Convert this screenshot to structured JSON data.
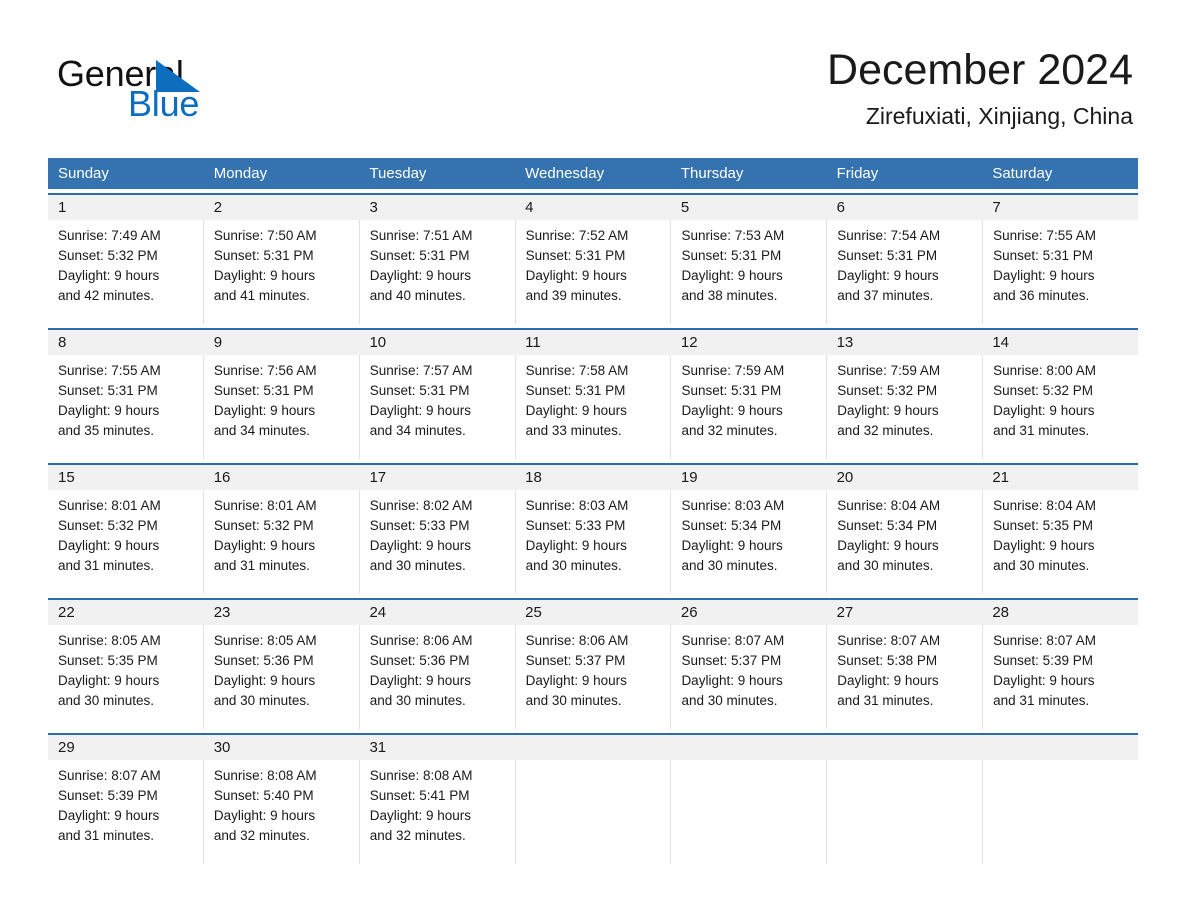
{
  "brand": {
    "name_part1": "General",
    "name_part2": "Blue",
    "triangle_color": "#0d6ebd",
    "blue_text_color": "#0d6ebd"
  },
  "header": {
    "month_title": "December 2024",
    "location": "Zirefuxiati, Xinjiang, China"
  },
  "theme": {
    "header_row_bg": "#3572b0",
    "week_divider": "#2c6cab",
    "daynum_band_bg": "#f1f1f1",
    "cell_bg": "#ffffff",
    "cell_divider": "#e2e2e2",
    "text": "#1a1a1a",
    "header_text": "#ffffff"
  },
  "weekdays": [
    "Sunday",
    "Monday",
    "Tuesday",
    "Wednesday",
    "Thursday",
    "Friday",
    "Saturday"
  ],
  "weeks": [
    [
      {
        "day": "1",
        "sunrise": "Sunrise: 7:49 AM",
        "sunset": "Sunset: 5:32 PM",
        "daylight_line1": "Daylight: 9 hours",
        "daylight_line2": "and 42 minutes."
      },
      {
        "day": "2",
        "sunrise": "Sunrise: 7:50 AM",
        "sunset": "Sunset: 5:31 PM",
        "daylight_line1": "Daylight: 9 hours",
        "daylight_line2": "and 41 minutes."
      },
      {
        "day": "3",
        "sunrise": "Sunrise: 7:51 AM",
        "sunset": "Sunset: 5:31 PM",
        "daylight_line1": "Daylight: 9 hours",
        "daylight_line2": "and 40 minutes."
      },
      {
        "day": "4",
        "sunrise": "Sunrise: 7:52 AM",
        "sunset": "Sunset: 5:31 PM",
        "daylight_line1": "Daylight: 9 hours",
        "daylight_line2": "and 39 minutes."
      },
      {
        "day": "5",
        "sunrise": "Sunrise: 7:53 AM",
        "sunset": "Sunset: 5:31 PM",
        "daylight_line1": "Daylight: 9 hours",
        "daylight_line2": "and 38 minutes."
      },
      {
        "day": "6",
        "sunrise": "Sunrise: 7:54 AM",
        "sunset": "Sunset: 5:31 PM",
        "daylight_line1": "Daylight: 9 hours",
        "daylight_line2": "and 37 minutes."
      },
      {
        "day": "7",
        "sunrise": "Sunrise: 7:55 AM",
        "sunset": "Sunset: 5:31 PM",
        "daylight_line1": "Daylight: 9 hours",
        "daylight_line2": "and 36 minutes."
      }
    ],
    [
      {
        "day": "8",
        "sunrise": "Sunrise: 7:55 AM",
        "sunset": "Sunset: 5:31 PM",
        "daylight_line1": "Daylight: 9 hours",
        "daylight_line2": "and 35 minutes."
      },
      {
        "day": "9",
        "sunrise": "Sunrise: 7:56 AM",
        "sunset": "Sunset: 5:31 PM",
        "daylight_line1": "Daylight: 9 hours",
        "daylight_line2": "and 34 minutes."
      },
      {
        "day": "10",
        "sunrise": "Sunrise: 7:57 AM",
        "sunset": "Sunset: 5:31 PM",
        "daylight_line1": "Daylight: 9 hours",
        "daylight_line2": "and 34 minutes."
      },
      {
        "day": "11",
        "sunrise": "Sunrise: 7:58 AM",
        "sunset": "Sunset: 5:31 PM",
        "daylight_line1": "Daylight: 9 hours",
        "daylight_line2": "and 33 minutes."
      },
      {
        "day": "12",
        "sunrise": "Sunrise: 7:59 AM",
        "sunset": "Sunset: 5:31 PM",
        "daylight_line1": "Daylight: 9 hours",
        "daylight_line2": "and 32 minutes."
      },
      {
        "day": "13",
        "sunrise": "Sunrise: 7:59 AM",
        "sunset": "Sunset: 5:32 PM",
        "daylight_line1": "Daylight: 9 hours",
        "daylight_line2": "and 32 minutes."
      },
      {
        "day": "14",
        "sunrise": "Sunrise: 8:00 AM",
        "sunset": "Sunset: 5:32 PM",
        "daylight_line1": "Daylight: 9 hours",
        "daylight_line2": "and 31 minutes."
      }
    ],
    [
      {
        "day": "15",
        "sunrise": "Sunrise: 8:01 AM",
        "sunset": "Sunset: 5:32 PM",
        "daylight_line1": "Daylight: 9 hours",
        "daylight_line2": "and 31 minutes."
      },
      {
        "day": "16",
        "sunrise": "Sunrise: 8:01 AM",
        "sunset": "Sunset: 5:32 PM",
        "daylight_line1": "Daylight: 9 hours",
        "daylight_line2": "and 31 minutes."
      },
      {
        "day": "17",
        "sunrise": "Sunrise: 8:02 AM",
        "sunset": "Sunset: 5:33 PM",
        "daylight_line1": "Daylight: 9 hours",
        "daylight_line2": "and 30 minutes."
      },
      {
        "day": "18",
        "sunrise": "Sunrise: 8:03 AM",
        "sunset": "Sunset: 5:33 PM",
        "daylight_line1": "Daylight: 9 hours",
        "daylight_line2": "and 30 minutes."
      },
      {
        "day": "19",
        "sunrise": "Sunrise: 8:03 AM",
        "sunset": "Sunset: 5:34 PM",
        "daylight_line1": "Daylight: 9 hours",
        "daylight_line2": "and 30 minutes."
      },
      {
        "day": "20",
        "sunrise": "Sunrise: 8:04 AM",
        "sunset": "Sunset: 5:34 PM",
        "daylight_line1": "Daylight: 9 hours",
        "daylight_line2": "and 30 minutes."
      },
      {
        "day": "21",
        "sunrise": "Sunrise: 8:04 AM",
        "sunset": "Sunset: 5:35 PM",
        "daylight_line1": "Daylight: 9 hours",
        "daylight_line2": "and 30 minutes."
      }
    ],
    [
      {
        "day": "22",
        "sunrise": "Sunrise: 8:05 AM",
        "sunset": "Sunset: 5:35 PM",
        "daylight_line1": "Daylight: 9 hours",
        "daylight_line2": "and 30 minutes."
      },
      {
        "day": "23",
        "sunrise": "Sunrise: 8:05 AM",
        "sunset": "Sunset: 5:36 PM",
        "daylight_line1": "Daylight: 9 hours",
        "daylight_line2": "and 30 minutes."
      },
      {
        "day": "24",
        "sunrise": "Sunrise: 8:06 AM",
        "sunset": "Sunset: 5:36 PM",
        "daylight_line1": "Daylight: 9 hours",
        "daylight_line2": "and 30 minutes."
      },
      {
        "day": "25",
        "sunrise": "Sunrise: 8:06 AM",
        "sunset": "Sunset: 5:37 PM",
        "daylight_line1": "Daylight: 9 hours",
        "daylight_line2": "and 30 minutes."
      },
      {
        "day": "26",
        "sunrise": "Sunrise: 8:07 AM",
        "sunset": "Sunset: 5:37 PM",
        "daylight_line1": "Daylight: 9 hours",
        "daylight_line2": "and 30 minutes."
      },
      {
        "day": "27",
        "sunrise": "Sunrise: 8:07 AM",
        "sunset": "Sunset: 5:38 PM",
        "daylight_line1": "Daylight: 9 hours",
        "daylight_line2": "and 31 minutes."
      },
      {
        "day": "28",
        "sunrise": "Sunrise: 8:07 AM",
        "sunset": "Sunset: 5:39 PM",
        "daylight_line1": "Daylight: 9 hours",
        "daylight_line2": "and 31 minutes."
      }
    ],
    [
      {
        "day": "29",
        "sunrise": "Sunrise: 8:07 AM",
        "sunset": "Sunset: 5:39 PM",
        "daylight_line1": "Daylight: 9 hours",
        "daylight_line2": "and 31 minutes."
      },
      {
        "day": "30",
        "sunrise": "Sunrise: 8:08 AM",
        "sunset": "Sunset: 5:40 PM",
        "daylight_line1": "Daylight: 9 hours",
        "daylight_line2": "and 32 minutes."
      },
      {
        "day": "31",
        "sunrise": "Sunrise: 8:08 AM",
        "sunset": "Sunset: 5:41 PM",
        "daylight_line1": "Daylight: 9 hours",
        "daylight_line2": "and 32 minutes."
      },
      {
        "day": "",
        "sunrise": "",
        "sunset": "",
        "daylight_line1": "",
        "daylight_line2": ""
      },
      {
        "day": "",
        "sunrise": "",
        "sunset": "",
        "daylight_line1": "",
        "daylight_line2": ""
      },
      {
        "day": "",
        "sunrise": "",
        "sunset": "",
        "daylight_line1": "",
        "daylight_line2": ""
      },
      {
        "day": "",
        "sunrise": "",
        "sunset": "",
        "daylight_line1": "",
        "daylight_line2": ""
      }
    ]
  ]
}
